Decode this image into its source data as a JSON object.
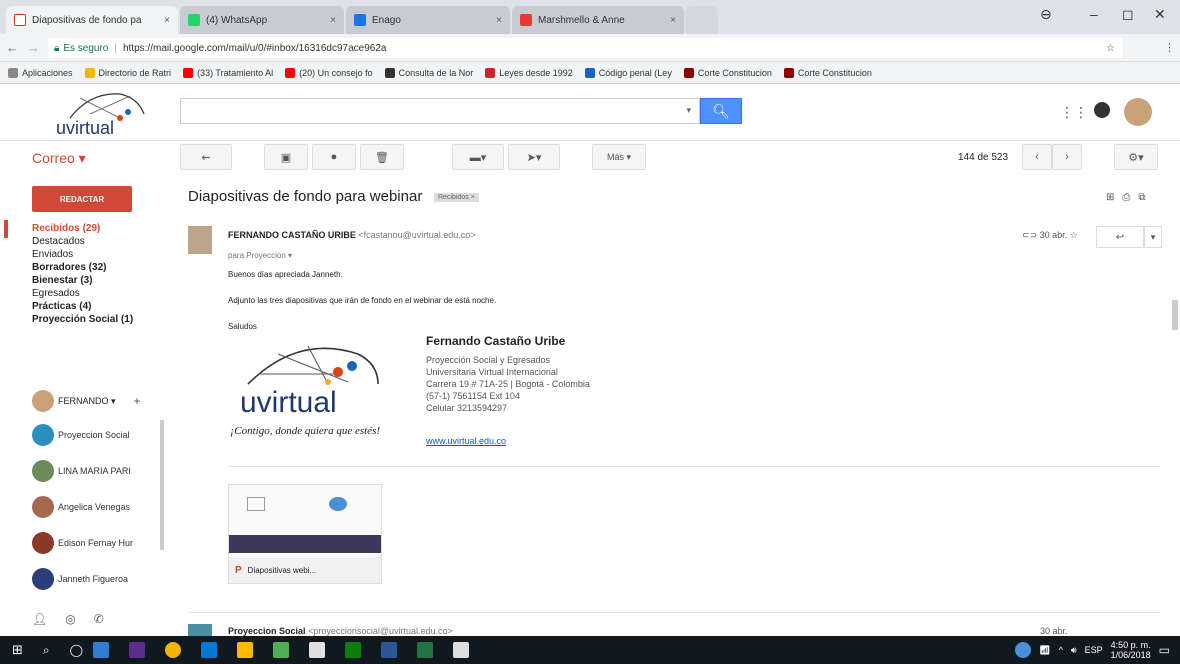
{
  "browser": {
    "tabs": [
      {
        "label": "Diapositivas de fondo pa",
        "close": "×",
        "color": "#d93025"
      },
      {
        "label": "(4) WhatsApp",
        "close": "×",
        "color": "#25d366"
      },
      {
        "label": "Enago",
        "close": "×",
        "color": "#1a73e8"
      },
      {
        "label": "Marshmello & Anne",
        "close": "×",
        "color": "#e53935"
      }
    ],
    "url_secure": "Es seguro",
    "url": "https://mail.google.com/mail/u/0/#inbox/16316dc97ace962a",
    "bookmarks": [
      {
        "label": "Aplicaciones",
        "color": "#888888"
      },
      {
        "label": "Directorio de Ratri",
        "color": "#f4b400"
      },
      {
        "label": "(33) Tratamiento Al",
        "color": "#ff0000"
      },
      {
        "label": "(20) Un consejo fo",
        "color": "#ff0000"
      },
      {
        "label": "Consulta de la Nor",
        "color": "#333333"
      },
      {
        "label": "Leyes desde 1992",
        "color": "#c62828"
      },
      {
        "label": "Código penal (Ley",
        "color": "#1565c0"
      },
      {
        "label": "Corte Constitucion",
        "color": "#8b0000"
      },
      {
        "label": "Corte Constitucion",
        "color": "#8b0000"
      }
    ]
  },
  "gmail": {
    "logo_text": "uvirtual",
    "correo_label": "Correo ▾",
    "compose_label": "REDACTAR",
    "folders": [
      {
        "label": "Recibidos (29)",
        "bold": true,
        "red": true
      },
      {
        "label": "Destacados",
        "bold": false
      },
      {
        "label": "Enviados",
        "bold": false
      },
      {
        "label": "Borradores (32)",
        "bold": true
      },
      {
        "label": "Bienestar (3)",
        "bold": true
      },
      {
        "label": "Egresados",
        "bold": false
      },
      {
        "label": "Prácticas (4)",
        "bold": true
      },
      {
        "label": "Proyección Social (1)",
        "bold": true
      }
    ],
    "chat_user": "FERNANDO ▾",
    "chat_add": "+",
    "contacts": [
      "Proyeccion Social",
      "LINA MARIA PARI",
      "Angelica Venegas",
      "Edison Fernay Hur",
      "Janneth Figueroa"
    ],
    "toolbar": {
      "more_label": "Más ▾",
      "pagination": "144 de 523"
    },
    "email": {
      "subject": "Diapositivas de fondo para webinar",
      "label_tag": "Recibidos",
      "sender_name": "FERNANDO CASTAÑO URIBE",
      "sender_email": "<fcastanou@uvirtual.edu.co>",
      "to_line": "para Proyeccion",
      "date": "30 abr.",
      "greeting": "Buenos días apreciada Janneth.",
      "body": "Adjunto las tres diapositivas que irán de fondo en el webinar de está noche.",
      "closing": "Saludos",
      "sig_logo_text": "uvirtual",
      "sig_tagline": "¡Contigo, donde quiera que estés!",
      "sig_name": "Fernando Castaño Uribe",
      "sig_lines": [
        "Proyección Social y Egresados",
        "Universitaria Virtual Internacional",
        "Carrera 19 # 71A-25 | Bogotá - Colombia",
        "(57-1) 7561154 Ext 104",
        "Celular 3213594297"
      ],
      "sig_link": "www.uvirtual.edu.co",
      "attachment_name": "Diapositivas webi...",
      "next_sender": "Proyeccion Social",
      "next_email": "<proyeccionsocial@uvirtual.edu.co>",
      "next_date": "30 abr."
    }
  },
  "taskbar": {
    "lang": "ESP",
    "time": "4:50 p. m.",
    "date": "1/06/2018"
  }
}
